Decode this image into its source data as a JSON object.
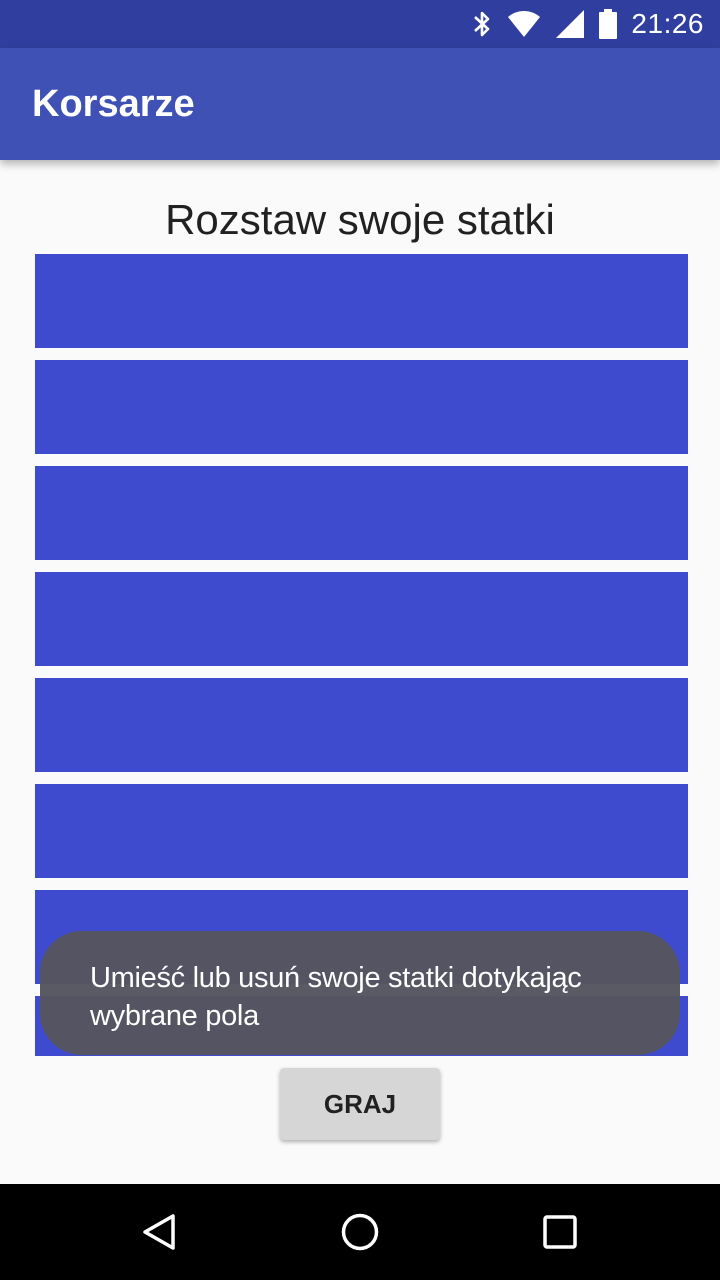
{
  "status_bar": {
    "time": "21:26",
    "icons": [
      "bluetooth-icon",
      "wifi-icon",
      "signal-icon",
      "battery-icon"
    ]
  },
  "app_bar": {
    "title": "Korsarze"
  },
  "main": {
    "heading": "Rozstaw swoje statki",
    "board_rows": 8,
    "row_color": "#3f4bce"
  },
  "toast": {
    "message_line1": "Umieść lub usuń swoje statki dotykając",
    "message_line2": "wybrane pola"
  },
  "play_button": {
    "label": "GRAJ"
  },
  "nav_bar": {
    "icons": [
      "back-icon",
      "home-icon",
      "recents-icon"
    ]
  },
  "colors": {
    "status_bar": "#303f9f",
    "app_bar": "#3f51b5",
    "background": "#fafafa",
    "button": "#d6d6d6"
  }
}
